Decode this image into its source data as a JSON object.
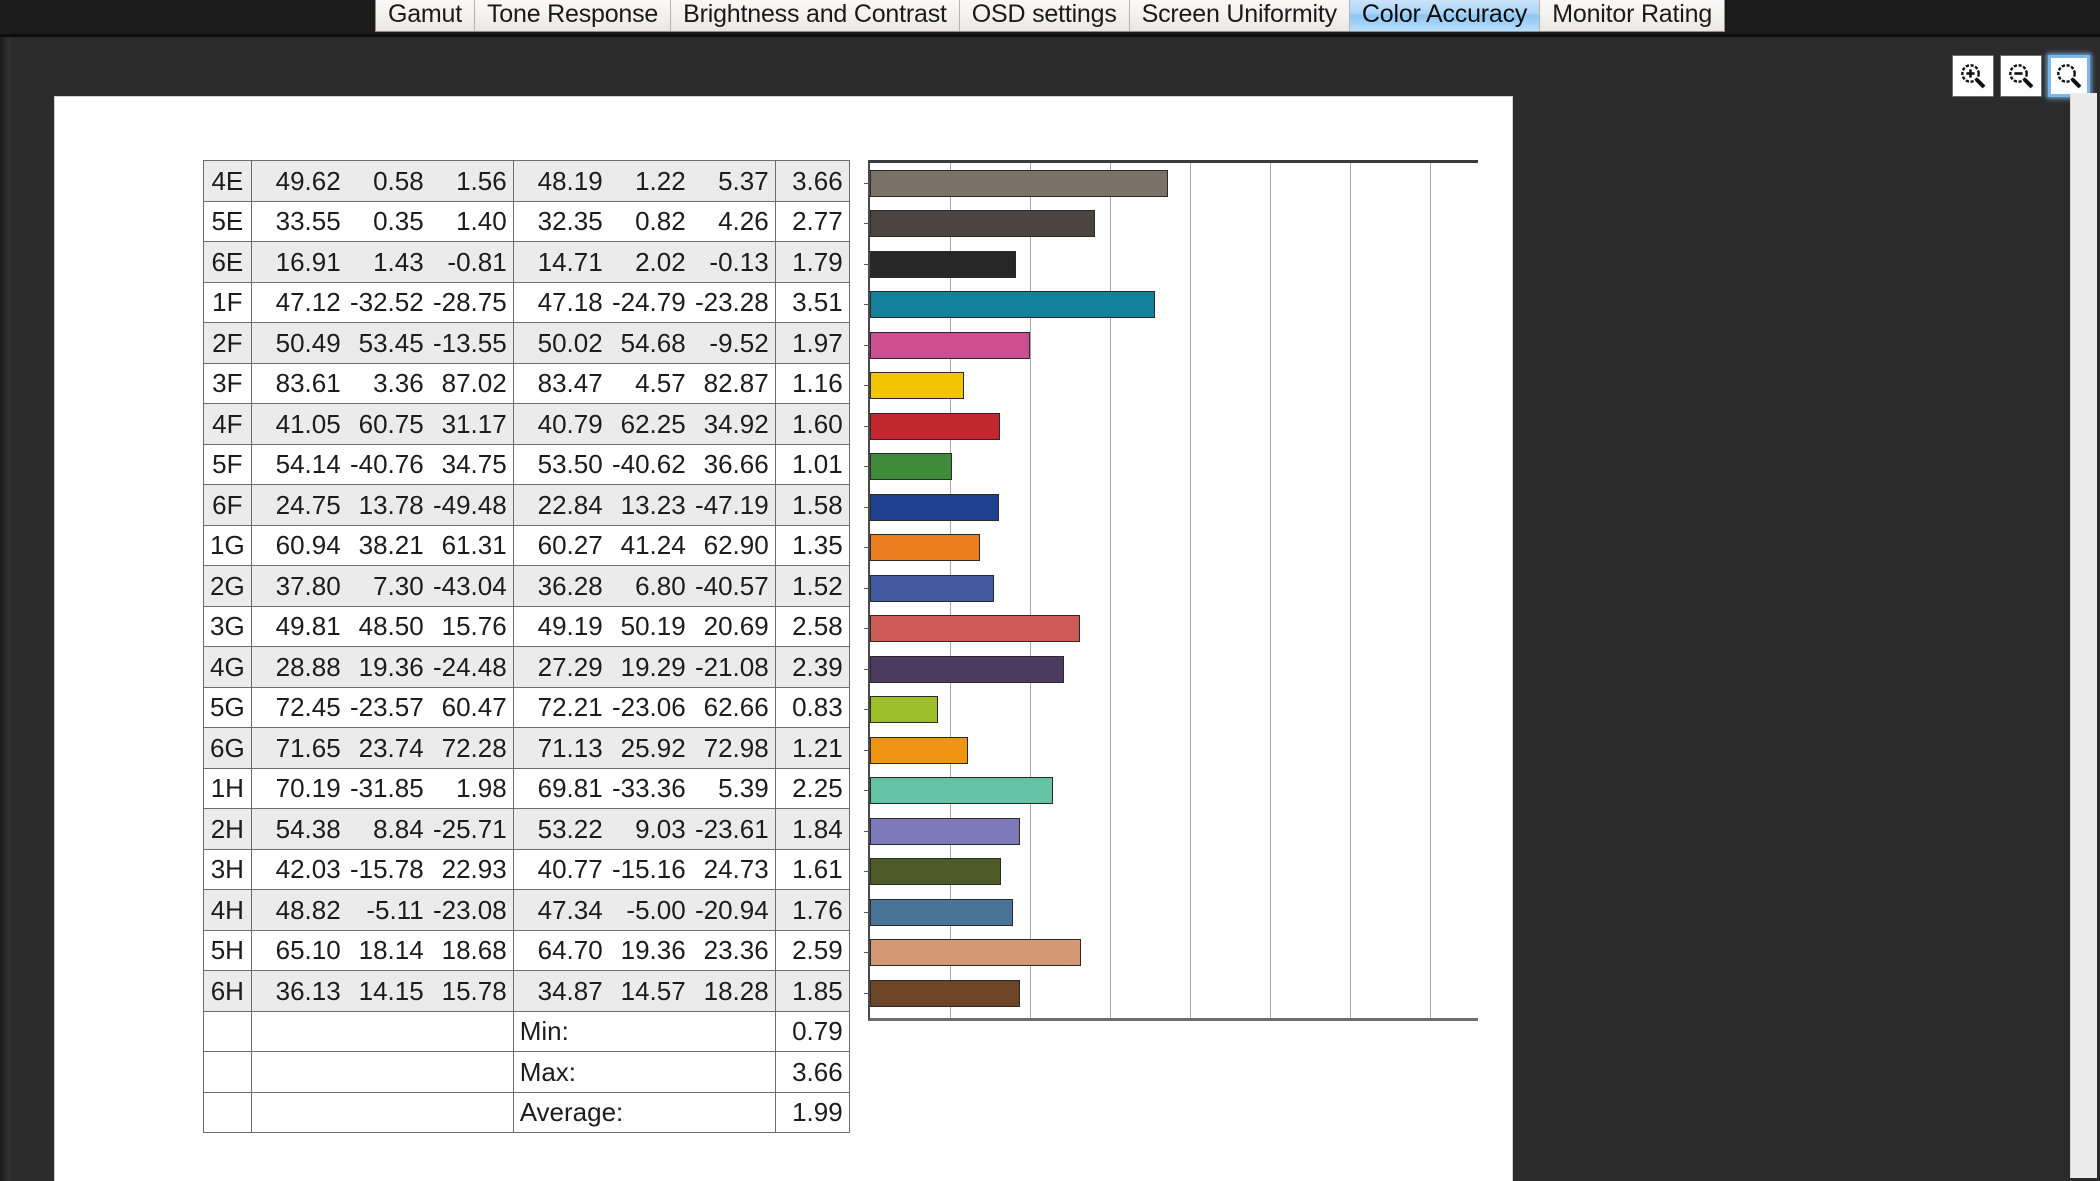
{
  "tabs": [
    {
      "label": "Gamut",
      "active": false
    },
    {
      "label": "Tone Response",
      "active": false
    },
    {
      "label": "Brightness and Contrast",
      "active": false
    },
    {
      "label": "OSD settings",
      "active": false
    },
    {
      "label": "Screen Uniformity",
      "active": false
    },
    {
      "label": "Color Accuracy",
      "active": true
    },
    {
      "label": "Monitor Rating",
      "active": false
    }
  ],
  "toolbar": {
    "zoom_in_label": "zoom-in",
    "zoom_out_label": "zoom-out",
    "zoom_fit_label": "zoom-fit"
  },
  "summary": {
    "min_label": "Min:",
    "min_value": "0.79",
    "max_label": "Max:",
    "max_value": "3.66",
    "average_label": "Average:",
    "average_value": "1.99"
  },
  "chart_data": {
    "type": "bar",
    "orientation": "horizontal",
    "title": "",
    "xlabel": "",
    "ylabel": "",
    "xlim": [
      0,
      7.5
    ],
    "grid": true,
    "gridline_step": 0.94,
    "legend": "none",
    "categories": [
      "4E",
      "5E",
      "6E",
      "1F",
      "2F",
      "3F",
      "4F",
      "5F",
      "6F",
      "1G",
      "2G",
      "3G",
      "4G",
      "5G",
      "6G",
      "1H",
      "2H",
      "3H",
      "4H",
      "5H",
      "6H"
    ],
    "values": [
      3.66,
      2.77,
      1.79,
      3.51,
      1.97,
      1.16,
      1.6,
      1.01,
      1.58,
      1.35,
      1.52,
      2.58,
      2.39,
      0.83,
      1.21,
      2.25,
      1.84,
      1.61,
      1.76,
      2.59,
      1.85
    ],
    "colors": [
      "#7a7266",
      "#4b4540",
      "#272727",
      "#14819b",
      "#cc4f93",
      "#f1c500",
      "#c1272d",
      "#3e8c3a",
      "#1f3f8f",
      "#ec7d1e",
      "#42599f",
      "#cc5a56",
      "#4c3b5e",
      "#9dbf2b",
      "#f09512",
      "#63c3a4",
      "#7e79b8",
      "#4e5a28",
      "#4a7398",
      "#d49875",
      "#6d4526"
    ],
    "rows": [
      {
        "label": "4E",
        "measured": [
          "49.62",
          "0.58",
          "1.56"
        ],
        "reference": [
          "48.19",
          "1.22",
          "5.37"
        ],
        "delta_e": "3.66",
        "color": "#7a7266"
      },
      {
        "label": "5E",
        "measured": [
          "33.55",
          "0.35",
          "1.40"
        ],
        "reference": [
          "32.35",
          "0.82",
          "4.26"
        ],
        "delta_e": "2.77",
        "color": "#4b4540"
      },
      {
        "label": "6E",
        "measured": [
          "16.91",
          "1.43",
          "-0.81"
        ],
        "reference": [
          "14.71",
          "2.02",
          "-0.13"
        ],
        "delta_e": "1.79",
        "color": "#272727"
      },
      {
        "label": "1F",
        "measured": [
          "47.12",
          "-32.52",
          "-28.75"
        ],
        "reference": [
          "47.18",
          "-24.79",
          "-23.28"
        ],
        "delta_e": "3.51",
        "color": "#14819b"
      },
      {
        "label": "2F",
        "measured": [
          "50.49",
          "53.45",
          "-13.55"
        ],
        "reference": [
          "50.02",
          "54.68",
          "-9.52"
        ],
        "delta_e": "1.97",
        "color": "#cc4f93"
      },
      {
        "label": "3F",
        "measured": [
          "83.61",
          "3.36",
          "87.02"
        ],
        "reference": [
          "83.47",
          "4.57",
          "82.87"
        ],
        "delta_e": "1.16",
        "color": "#f1c500"
      },
      {
        "label": "4F",
        "measured": [
          "41.05",
          "60.75",
          "31.17"
        ],
        "reference": [
          "40.79",
          "62.25",
          "34.92"
        ],
        "delta_e": "1.60",
        "color": "#c1272d"
      },
      {
        "label": "5F",
        "measured": [
          "54.14",
          "-40.76",
          "34.75"
        ],
        "reference": [
          "53.50",
          "-40.62",
          "36.66"
        ],
        "delta_e": "1.01",
        "color": "#3e8c3a"
      },
      {
        "label": "6F",
        "measured": [
          "24.75",
          "13.78",
          "-49.48"
        ],
        "reference": [
          "22.84",
          "13.23",
          "-47.19"
        ],
        "delta_e": "1.58",
        "color": "#1f3f8f"
      },
      {
        "label": "1G",
        "measured": [
          "60.94",
          "38.21",
          "61.31"
        ],
        "reference": [
          "60.27",
          "41.24",
          "62.90"
        ],
        "delta_e": "1.35",
        "color": "#ec7d1e"
      },
      {
        "label": "2G",
        "measured": [
          "37.80",
          "7.30",
          "-43.04"
        ],
        "reference": [
          "36.28",
          "6.80",
          "-40.57"
        ],
        "delta_e": "1.52",
        "color": "#42599f"
      },
      {
        "label": "3G",
        "measured": [
          "49.81",
          "48.50",
          "15.76"
        ],
        "reference": [
          "49.19",
          "50.19",
          "20.69"
        ],
        "delta_e": "2.58",
        "color": "#cc5a56"
      },
      {
        "label": "4G",
        "measured": [
          "28.88",
          "19.36",
          "-24.48"
        ],
        "reference": [
          "27.29",
          "19.29",
          "-21.08"
        ],
        "delta_e": "2.39",
        "color": "#4c3b5e"
      },
      {
        "label": "5G",
        "measured": [
          "72.45",
          "-23.57",
          "60.47"
        ],
        "reference": [
          "72.21",
          "-23.06",
          "62.66"
        ],
        "delta_e": "0.83",
        "color": "#9dbf2b"
      },
      {
        "label": "6G",
        "measured": [
          "71.65",
          "23.74",
          "72.28"
        ],
        "reference": [
          "71.13",
          "25.92",
          "72.98"
        ],
        "delta_e": "1.21",
        "color": "#f09512"
      },
      {
        "label": "1H",
        "measured": [
          "70.19",
          "-31.85",
          "1.98"
        ],
        "reference": [
          "69.81",
          "-33.36",
          "5.39"
        ],
        "delta_e": "2.25",
        "color": "#63c3a4"
      },
      {
        "label": "2H",
        "measured": [
          "54.38",
          "8.84",
          "-25.71"
        ],
        "reference": [
          "53.22",
          "9.03",
          "-23.61"
        ],
        "delta_e": "1.84",
        "color": "#7e79b8"
      },
      {
        "label": "3H",
        "measured": [
          "42.03",
          "-15.78",
          "22.93"
        ],
        "reference": [
          "40.77",
          "-15.16",
          "24.73"
        ],
        "delta_e": "1.61",
        "color": "#4e5a28"
      },
      {
        "label": "4H",
        "measured": [
          "48.82",
          "-5.11",
          "-23.08"
        ],
        "reference": [
          "47.34",
          "-5.00",
          "-20.94"
        ],
        "delta_e": "1.76",
        "color": "#4a7398"
      },
      {
        "label": "5H",
        "measured": [
          "65.10",
          "18.14",
          "18.68"
        ],
        "reference": [
          "64.70",
          "19.36",
          "23.36"
        ],
        "delta_e": "2.59",
        "color": "#d49875"
      },
      {
        "label": "6H",
        "measured": [
          "36.13",
          "14.15",
          "15.78"
        ],
        "reference": [
          "34.87",
          "14.57",
          "18.28"
        ],
        "delta_e": "1.85",
        "color": "#6d4526"
      }
    ]
  }
}
